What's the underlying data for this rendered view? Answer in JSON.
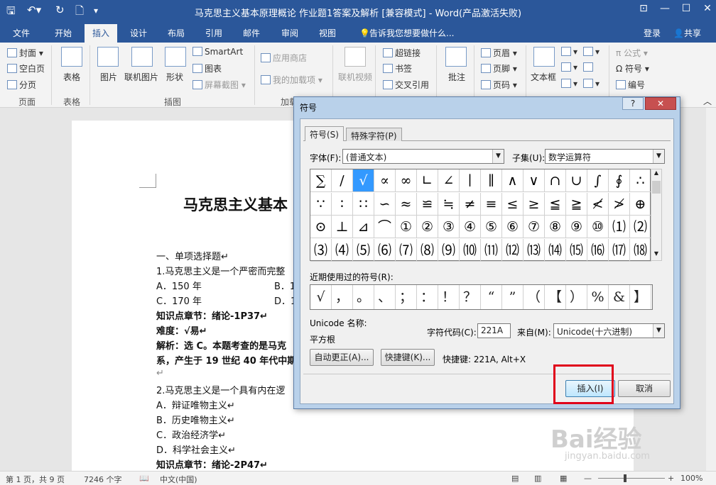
{
  "app": {
    "title": "马克思主义基本原理概论 作业题1答案及解析 [兼容模式] - Word(产品激活失败)",
    "window_buttons": [
      "⊡",
      "—",
      "☐",
      "✕"
    ]
  },
  "tabs": [
    "文件",
    "开始",
    "插入",
    "设计",
    "布局",
    "引用",
    "邮件",
    "审阅",
    "视图"
  ],
  "tell_me": "告诉我您想要做什么...",
  "account": {
    "login": "登录",
    "share": "共享"
  },
  "ribbon": {
    "pages": {
      "cover": "封面",
      "blank": "空白页",
      "break": "分页",
      "group": "页面"
    },
    "table": {
      "label": "表格",
      "group": "表格"
    },
    "illustrations": {
      "picture": "图片",
      "online_picture": "联机图片",
      "shapes": "形状",
      "smartart": "SmartArt",
      "chart": "图表",
      "screenshot": "屏幕截图",
      "group": "插图"
    },
    "addins": {
      "store": "应用商店",
      "my_addins": "我的加载项",
      "group": "加载"
    },
    "media": {
      "online_video": "联机视频"
    },
    "links": {
      "hyperlink": "超链接",
      "bookmark": "书签",
      "cross_ref": "交叉引用"
    },
    "comments": {
      "comment": "批注"
    },
    "header_footer": {
      "header": "页眉",
      "footer": "页脚",
      "page_number": "页码"
    },
    "text": {
      "textbox": "文本框"
    },
    "symbols": {
      "equation": "公式",
      "symbol": "符号",
      "number": "编号"
    }
  },
  "document": {
    "title": "马克思主义基本",
    "lines": [
      "一、单项选择题↵",
      "1.马克思主义是一个严密而完整",
      "A．150 年",
      "B．1",
      "C．170 年",
      "D．1",
      "知识点章节：绪论-1P37↵",
      "难度：√易↵",
      "解析：选 C。本题考查的是马克",
      "系，产生于 19 世纪 40 年代中期",
      "↵",
      "2.马克思主义是一个具有内在逻",
      "A．辩证唯物主义↵",
      "B．历史唯物主义↵",
      "C．政治经济学↵",
      "D．科学社会主义↵",
      "知识点章节：绪论-2P47↵"
    ]
  },
  "status": {
    "page": "第 1 页，共 9 页",
    "words": "7246 个字",
    "lang": "中文(中国)",
    "zoom": "100%"
  },
  "dialog": {
    "title": "符号",
    "help": "?",
    "close": "✕",
    "tab_symbols": "符号(S)",
    "tab_special": "特殊字符(P)",
    "font_label": "字体(F):",
    "font_value": "(普通文本)",
    "subset_label": "子集(U):",
    "subset_value": "数学运算符",
    "grid_rows": [
      [
        "∑",
        "∕",
        "√",
        "∝",
        "∞",
        "∟",
        "∠",
        "∣",
        "∥",
        "∧",
        "∨",
        "∩",
        "∪",
        "∫",
        "∮",
        "∴"
      ],
      [
        "∵",
        "∶",
        "∷",
        "∽",
        "≈",
        "≌",
        "≒",
        "≠",
        "≡",
        "≤",
        "≥",
        "≦",
        "≧",
        "≮",
        "≯",
        "⊕"
      ],
      [
        "⊙",
        "⊥",
        "⊿",
        "⌒",
        "①",
        "②",
        "③",
        "④",
        "⑤",
        "⑥",
        "⑦",
        "⑧",
        "⑨",
        "⑩",
        "⑴",
        "⑵"
      ],
      [
        "⑶",
        "⑷",
        "⑸",
        "⑹",
        "⑺",
        "⑻",
        "⑼",
        "⑽",
        "⑾",
        "⑿",
        "⒀",
        "⒁",
        "⒂",
        "⒃",
        "⒄",
        "⒅"
      ]
    ],
    "recent_label": "近期使用过的符号(R):",
    "recent": [
      "√",
      "，",
      "。",
      "、",
      "；",
      "：",
      "！",
      "？",
      "“",
      "”",
      "（",
      "【",
      "）",
      "%",
      "&",
      "】"
    ],
    "unicode_name_label": "Unicode 名称:",
    "unicode_name": "平方根",
    "char_code_label": "字符代码(C):",
    "char_code": "221A",
    "from_label": "来自(M):",
    "from_value": "Unicode(十六进制)",
    "autocorrect": "自动更正(A)...",
    "shortcut_key": "快捷键(K)...",
    "shortcut_info": "快捷键: 221A, Alt+X",
    "insert": "插入(I)",
    "cancel": "取消"
  },
  "watermark": {
    "text": "Bai经验",
    "url": "jingyan.baidu.com"
  }
}
